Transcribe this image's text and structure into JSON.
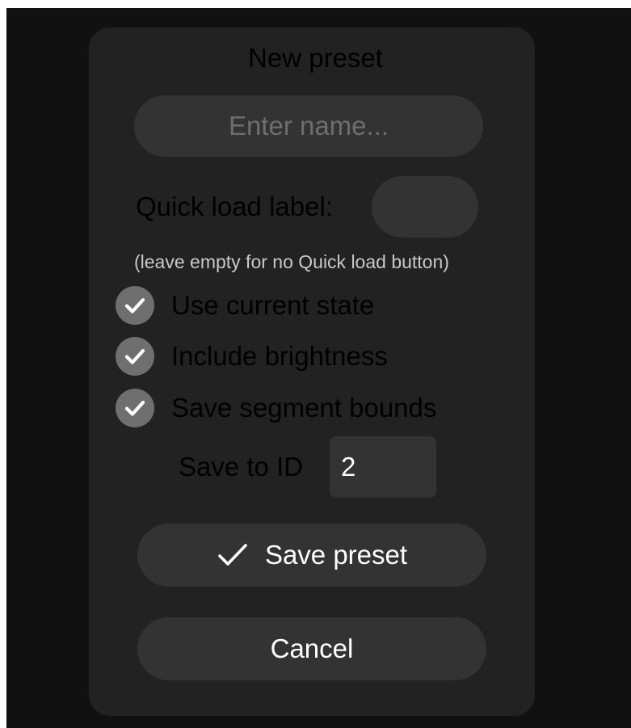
{
  "dialog": {
    "title": "New preset",
    "name_input": {
      "value": "",
      "placeholder": "Enter name..."
    },
    "quick_load": {
      "label": "Quick load label:",
      "value": "",
      "hint": "(leave empty for no Quick load button)"
    },
    "options": [
      {
        "label": "Use current state",
        "checked": true,
        "icon": "check-icon"
      },
      {
        "label": "Include brightness",
        "checked": true,
        "icon": "check-icon"
      },
      {
        "label": "Save segment bounds",
        "checked": true,
        "icon": "check-icon"
      }
    ],
    "save_to_id": {
      "label": "Save to ID",
      "value": "2"
    },
    "save_button": {
      "label": "Save preset",
      "icon": "check-icon"
    },
    "cancel_button": {
      "label": "Cancel"
    }
  },
  "colors": {
    "background": "#111111",
    "panel": "#222222",
    "control": "#333333",
    "checkbox": "#6f6f6f",
    "text": "#ffffff",
    "placeholder": "#6e6e6e"
  }
}
